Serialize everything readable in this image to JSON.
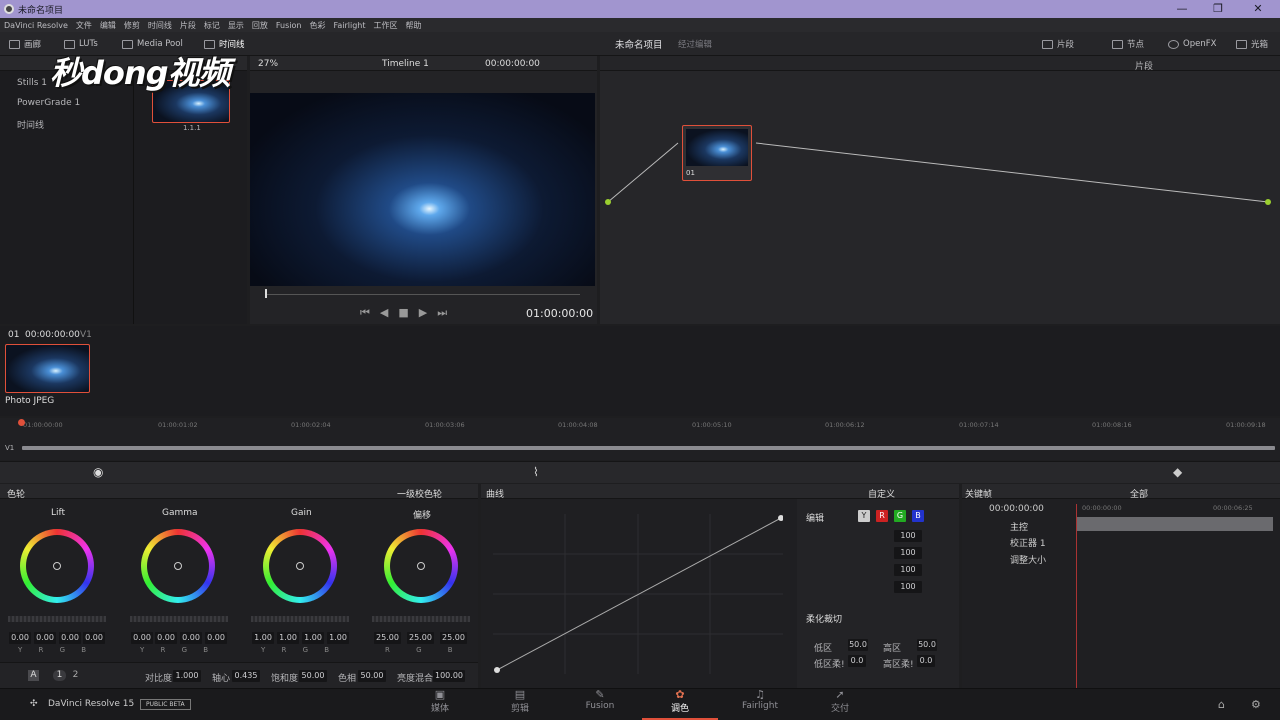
{
  "window": {
    "title": "未命名项目",
    "minimize": "—",
    "maximize": "❐",
    "close": "✕"
  },
  "menu": [
    "DaVinci Resolve",
    "文件",
    "编辑",
    "修剪",
    "时间线",
    "片段",
    "标记",
    "显示",
    "回放",
    "Fusion",
    "色彩",
    "Fairlight",
    "工作区",
    "帮助"
  ],
  "toolbar": {
    "left": [
      "画廊",
      "LUTs",
      "Media Pool",
      "时间线"
    ],
    "project_title": "未命名项目",
    "project_sub": "经过编辑",
    "right": [
      "片段",
      "节点",
      "OpenFX",
      "光箱"
    ]
  },
  "watermark": "秒dong视频",
  "gallery": {
    "items": [
      "Stills 1",
      "PowerGrade 1",
      "时间线"
    ],
    "still_label": "1.1.1"
  },
  "viewer": {
    "zoom": "27%",
    "timeline": "Timeline 1",
    "timecode": "00:00:00:00",
    "playhead_tc": "01:00:00:00"
  },
  "nodes": {
    "mode": "片段",
    "node_label": "01"
  },
  "clips": {
    "index": "01",
    "tc": "00:00:00:00",
    "track": "V1",
    "clip_name": "Photo JPEG"
  },
  "ruler": [
    "01:00:00:00",
    "01:00:01:02",
    "01:00:02:04",
    "01:00:03:06",
    "01:00:04:08",
    "01:00:05:10",
    "01:00:06:12",
    "01:00:07:14",
    "01:00:08:16",
    "01:00:09:18"
  ],
  "ruler_track": "V1",
  "color_wheels": {
    "title": "色轮",
    "mode": "一级校色轮",
    "wheels": [
      {
        "label": "Lift",
        "values": [
          "0.00",
          "0.00",
          "0.00",
          "0.00"
        ]
      },
      {
        "label": "Gamma",
        "values": [
          "0.00",
          "0.00",
          "0.00",
          "0.00"
        ]
      },
      {
        "label": "Gain",
        "values": [
          "1.00",
          "1.00",
          "1.00",
          "1.00"
        ]
      },
      {
        "label": "偏移",
        "values": [
          "25.00",
          "25.00",
          "25.00"
        ]
      }
    ],
    "channels4": [
      "Y",
      "R",
      "G",
      "B"
    ],
    "channels3": [
      "R",
      "G",
      "B"
    ],
    "bottom": {
      "a": "A",
      "p1": "1",
      "p2": "2",
      "contrast_label": "对比度",
      "contrast": "1.000",
      "pivot_label": "轴心",
      "pivot": "0.435",
      "sat_label": "饱和度",
      "sat": "50.00",
      "hue_label": "色相",
      "hue": "50.00",
      "lum_label": "亮度混合",
      "lum": "100.00"
    }
  },
  "curves": {
    "title": "曲线",
    "mode": "自定义",
    "edit_label": "编辑",
    "chan": [
      "Y",
      "R",
      "G",
      "B"
    ],
    "intensities": [
      "100",
      "100",
      "100",
      "100"
    ],
    "soft_clip": "柔化裁切",
    "low_label": "低区",
    "low": "50.0",
    "high_label": "高区",
    "high": "50.0",
    "ls_label": "低区柔!",
    "ls": "0.0",
    "hs_label": "高区柔!",
    "hs": "0.0"
  },
  "keyframes": {
    "title": "关键帧",
    "mode": "全部",
    "tc1": "00:00:00:00",
    "tc2": "00:00:06:25",
    "rows": [
      "主控",
      "校正器 1",
      "调整大小"
    ]
  },
  "footer": {
    "app": "DaVinci Resolve 15",
    "badge": "PUBLIC BETA"
  },
  "pages": [
    "媒体",
    "剪辑",
    "Fusion",
    "调色",
    "Fairlight",
    "交付"
  ],
  "active_page": "调色",
  "colors": {
    "titlebar": "#a195cf",
    "accent_red": "#e0503a",
    "node_green": "#9bcf2f"
  }
}
